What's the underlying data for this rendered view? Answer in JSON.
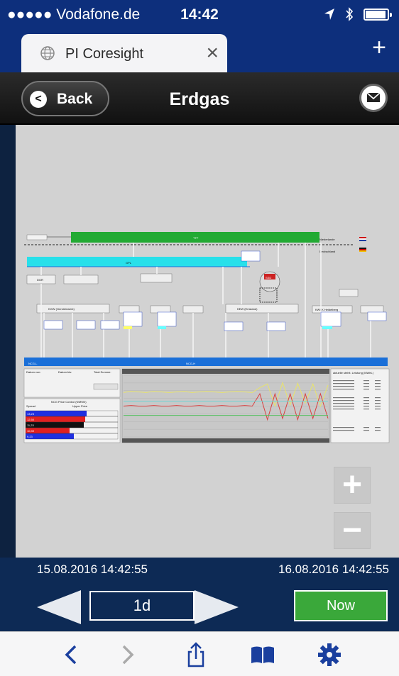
{
  "status": {
    "carrier": "●●●●● Vodafone.de",
    "time": "14:42"
  },
  "tab": {
    "title": "PI Coresight",
    "close_glyph": "×",
    "newtab_glyph": "+"
  },
  "nav": {
    "back_label": "Back",
    "title": "Erdgas"
  },
  "scada": {
    "ttf": "TTF",
    "gpl": "GPL",
    "ncg_l": "NCG-L",
    "ncg_h": "NCG-H",
    "niederlande": "Niederlande",
    "deutschland": "Deutschland",
    "dgr": "DGR",
    "kgw": "KGW (Gersteinwerk)",
    "kew": "KEW (Emsland)",
    "kwkk": "KWKK Heidelberg",
    "ssd": "SSD",
    "price_panel_title": "NCG Price Control (€/MWh)",
    "spread": "Spread",
    "upper_price": "Upper Price",
    "prices": [
      "13,23",
      "12,50",
      "11,23",
      "10,39",
      "9,23"
    ],
    "list_title": "aktuelle stehlt. Leistung (MWeL)",
    "datum_von": "Datum von:",
    "datum_bis": "Datum bis:",
    "total_summe": "Total Summe:",
    "zoom_in": "+",
    "zoom_out": "−"
  },
  "chart_data": {
    "type": "line",
    "series": [
      {
        "values": [
          0.72,
          0.74,
          0.73,
          0.72,
          0.74,
          0.73,
          0.72,
          0.73,
          0.74,
          0.72,
          0.73,
          0.74,
          0.73,
          0.72,
          0.73,
          0.74,
          0.73,
          0.72,
          0.8,
          0.86,
          0.5,
          0.88,
          0.52,
          0.87,
          0.55,
          0.86,
          0.5,
          0.84
        ]
      },
      {
        "values": [
          0.5,
          0.51,
          0.5,
          0.5,
          0.51,
          0.5,
          0.5,
          0.51,
          0.5,
          0.5,
          0.51,
          0.5,
          0.5,
          0.51,
          0.5,
          0.5,
          0.51,
          0.5,
          0.7,
          0.28,
          0.7,
          0.3,
          0.7,
          0.28,
          0.7,
          0.3,
          0.7,
          0.3
        ]
      },
      {
        "values": [
          0.35,
          0.35,
          0.35,
          0.35,
          0.35,
          0.35,
          0.35,
          0.35,
          0.35,
          0.35,
          0.35,
          0.35,
          0.35,
          0.35,
          0.35,
          0.35,
          0.35,
          0.35,
          0.35,
          0.35,
          0.35,
          0.35,
          0.35,
          0.35,
          0.35,
          0.35,
          0.35,
          0.35
        ]
      },
      {
        "values": [
          0.58,
          0.58,
          0.58,
          0.58,
          0.58,
          0.58,
          0.58,
          0.58,
          0.58,
          0.58,
          0.58,
          0.58,
          0.58,
          0.58,
          0.58,
          0.58,
          0.58,
          0.58,
          0.58,
          0.58,
          0.58,
          0.58,
          0.58,
          0.58,
          0.58,
          0.58,
          0.58,
          0.58
        ]
      }
    ],
    "colors": [
      "#e8e36a",
      "#d94040",
      "#55c060",
      "#6fd4d4"
    ]
  },
  "timerange": {
    "start": "15.08.2016 14:42:55",
    "end": "16.08.2016 14:42:55"
  },
  "controls": {
    "range": "1d",
    "now_label": "Now"
  },
  "colors": {
    "header_blue": "#0d2f7c",
    "ttf_green": "#22aa33",
    "gpl_cyan": "#28e0ea",
    "ncg_blue": "#1a6fd8",
    "now_green": "#3aa83a"
  }
}
